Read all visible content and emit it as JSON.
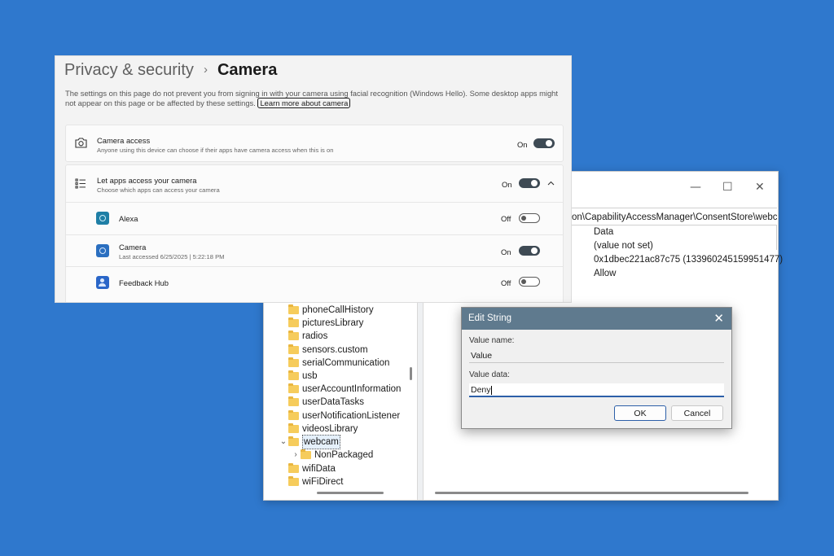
{
  "regedit": {
    "window_controls": {
      "minimize": "—",
      "maximize": "☐",
      "close": "✕"
    },
    "address": "on\\CapabilityAccessManager\\ConsentStore\\webcam",
    "values_column_header": "Data",
    "values": [
      "(value not set)",
      "0x1dbec221ac87c75 (133960245159951477)",
      "Allow"
    ],
    "tree": [
      {
        "label": "phoneCallHistory"
      },
      {
        "label": "picturesLibrary"
      },
      {
        "label": "radios"
      },
      {
        "label": "sensors.custom"
      },
      {
        "label": "serialCommunication"
      },
      {
        "label": "usb"
      },
      {
        "label": "userAccountInformation"
      },
      {
        "label": "userDataTasks"
      },
      {
        "label": "userNotificationListener"
      },
      {
        "label": "videosLibrary"
      },
      {
        "label": "webcam",
        "expanded": true,
        "selected": true
      },
      {
        "label": "NonPackaged",
        "child": true
      },
      {
        "label": "wifiData"
      },
      {
        "label": "wiFiDirect"
      }
    ]
  },
  "settings": {
    "breadcrumb": {
      "parent": "Privacy & security",
      "separator": "›",
      "current": "Camera"
    },
    "description": "The settings on this page do not prevent you from signing in with your camera using facial recognition (Windows Hello). Some desktop apps might not appear on this page or be affected by these settings.",
    "learn_more": "Learn more about camera",
    "camera_access": {
      "title": "Camera access",
      "subtitle": "Anyone using this device can choose if their apps have camera access when this is on",
      "state": "On"
    },
    "let_apps": {
      "title": "Let apps access your camera",
      "subtitle": "Choose which apps can access your camera",
      "state": "On"
    },
    "apps": [
      {
        "name": "Alexa",
        "subtitle": "",
        "state": "Off",
        "color": "#1f7fa6"
      },
      {
        "name": "Camera",
        "subtitle": "Last accessed 6/25/2025  |  5:22:18 PM",
        "state": "On",
        "color": "#2b6fc0"
      },
      {
        "name": "Feedback Hub",
        "subtitle": "",
        "state": "Off",
        "color": "#2a66c8"
      }
    ]
  },
  "dialog": {
    "title": "Edit String",
    "close": "✕",
    "value_name_label": "Value name:",
    "value_name": "Value",
    "value_data_label": "Value data:",
    "value_data": "Deny",
    "ok": "OK",
    "cancel": "Cancel"
  },
  "colors": {
    "background": "#2f78cd",
    "toggle_on": "#3e4a54",
    "dialog_title": "#5f7a8e",
    "accent_underline": "#2c5fa8"
  }
}
